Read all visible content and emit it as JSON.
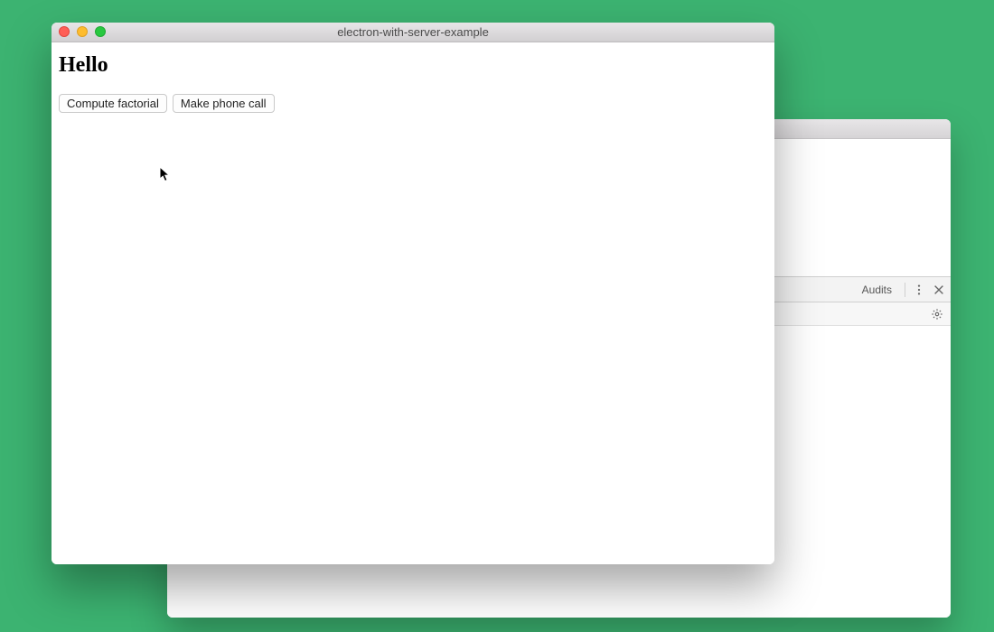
{
  "front_window": {
    "title": "electron-with-server-example",
    "heading": "Hello",
    "buttons": {
      "compute_factorial": "Compute factorial",
      "make_phone_call": "Make phone call"
    }
  },
  "back_window": {
    "tabs": {
      "audits": "Audits"
    },
    "icons": {
      "more": "more-vertical-icon",
      "close": "close-icon",
      "settings": "gear-icon"
    }
  }
}
